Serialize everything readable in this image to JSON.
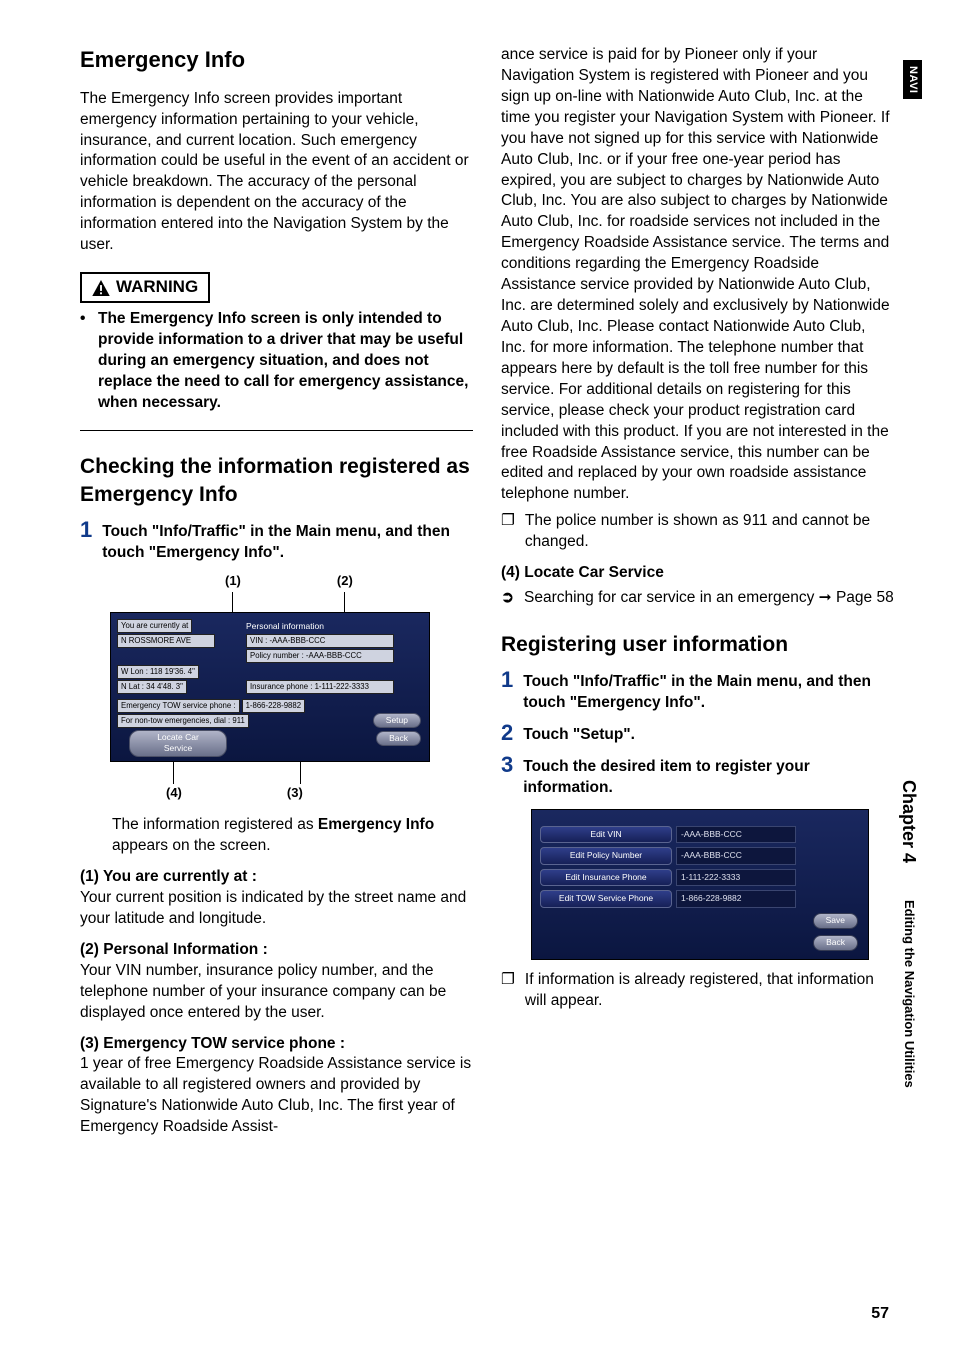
{
  "side": {
    "navi": "NAVI",
    "chapter": "Chapter 4",
    "subtitle": "Editing the Navigation Utilities"
  },
  "page_number": "57",
  "left": {
    "h1": "Emergency Info",
    "intro": "The Emergency Info screen provides important emergency information pertaining to your vehicle, insurance, and current location. Such emergency information could be useful in the event of an accident or vehicle breakdown. The accuracy of the personal information is dependent on the accuracy of the information entered into the Navigation System by the user.",
    "warning_label": "WARNING",
    "warning_text": "The Emergency Info screen is only intended to provide information to a driver that may be useful during an emergency situation, and does not replace the need to call for emergency assistance, when necessary.",
    "h2": "Checking the information registered as Emergency Info",
    "step1": "Touch \"Info/Traffic\" in the Main menu, and then touch \"Emergency Info\".",
    "fig1": {
      "label_1": "(1)",
      "label_2": "(2)",
      "label_3": "(3)",
      "label_4": "(4)",
      "currently_at": "You are currently at",
      "street": "N ROSSMORE AVE",
      "wlon": "W Lon : 118 19'36. 4\"",
      "nlat": "N Lat :  34  4'48. 3\"",
      "personal_info": "Personal information",
      "vin": "VIN : -AAA-BBB-CCC",
      "policy": "Policy number : -AAA-BBB-CCC",
      "ins_phone": "Insurance phone : 1-111-222-3333",
      "tow_line": "Emergency TOW service phone :",
      "tow_num": "1-866-228-9882",
      "nontow": "For non-tow emergencies, dial : 911",
      "locate_btn": "Locate Car Service",
      "setup_btn": "Setup",
      "back_btn": "Back"
    },
    "after_fig": "The information registered as ",
    "after_fig_b": "Emergency Info",
    "after_fig_2": " appears on the screen.",
    "sec1_h": "(1) You are currently at :",
    "sec1_p": "Your current position is indicated by the street name and your latitude and longitude.",
    "sec2_h": "(2) Personal Information :",
    "sec2_p": "Your VIN number, insurance policy number, and the telephone number of your insurance company can be displayed once entered by the user.",
    "sec3_h": "(3) Emergency TOW service phone :",
    "sec3_p": "1 year of free Emergency Roadside Assistance service is available to all registered owners and provided by Signature's Nationwide Auto Club, Inc. The first year of Emergency Roadside Assist-"
  },
  "right": {
    "cont": "ance service is paid for by Pioneer only if your Navigation System is registered with Pioneer and you sign up on-line with Nationwide Auto Club, Inc. at the time you register your Navigation System with Pioneer. If you have not signed up for this service with Nationwide Auto Club, Inc. or if your free one-year period has expired, you are subject to charges by Nationwide Auto Club, Inc. You are also subject to charges by Nationwide Auto Club, Inc. for roadside services not included in the Emergency Roadside Assistance service. The terms and conditions regarding the Emergency Roadside Assistance service provided by Nationwide Auto Club, Inc. are determined solely and exclusively by Nationwide Auto Club, Inc. Please contact Nationwide Auto Club, Inc. for more information. The telephone number that appears here by default is the toll free number for this service. For additional details on registering for this service, please check your product registration card included with this product. If you are not interested in the free Roadside Assistance service, this number can be edited and replaced by your own roadside assistance telephone number.",
    "boxnote": "The police number is shown as 911 and cannot be changed.",
    "sec4_h": "(4) Locate Car Service",
    "sec4_p_pre": "Searching for car service in an emergency ",
    "sec4_p_post": " Page 58",
    "h2b": "Registering user information",
    "r_step1": "Touch \"Info/Traffic\" in the Main menu, and then touch \"Emergency Info\".",
    "r_step2": "Touch \"Setup\".",
    "r_step3": "Touch the desired item to register your information.",
    "fig2": {
      "edit_vin": "Edit VIN",
      "vin_val": "-AAA-BBB-CCC",
      "edit_policy": "Edit Policy Number",
      "policy_val": "-AAA-BBB-CCC",
      "edit_ins": "Edit Insurance Phone",
      "ins_val": "1-111-222-3333",
      "edit_tow": "Edit TOW Service Phone",
      "tow_val": "1-866-228-9882",
      "save": "Save",
      "back": "Back"
    },
    "boxnote2": "If information is already registered, that information will appear."
  }
}
